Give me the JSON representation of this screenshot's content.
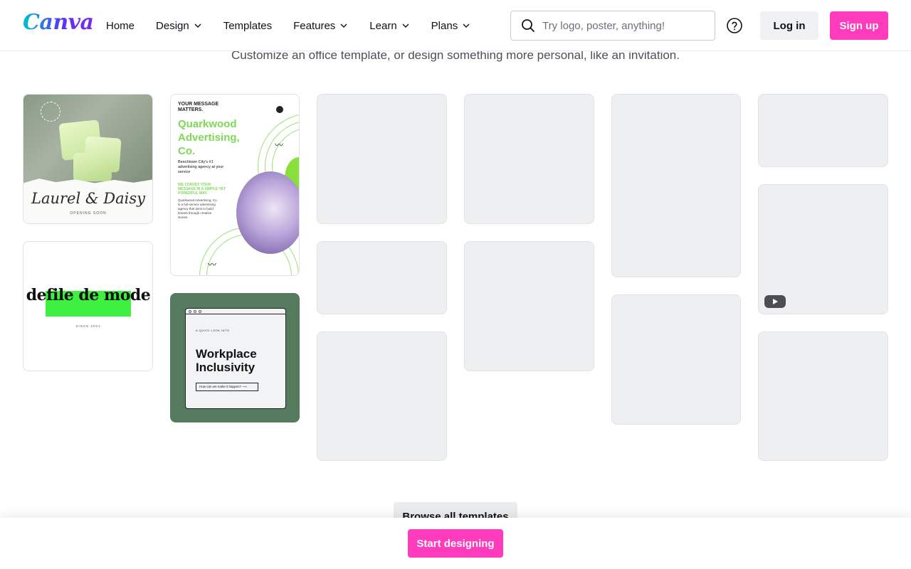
{
  "header": {
    "logo": "Canva",
    "nav": [
      {
        "label": "Home",
        "dropdown": false
      },
      {
        "label": "Design",
        "dropdown": true
      },
      {
        "label": "Templates",
        "dropdown": false
      },
      {
        "label": "Features",
        "dropdown": true
      },
      {
        "label": "Learn",
        "dropdown": true
      },
      {
        "label": "Plans",
        "dropdown": true
      }
    ],
    "search": {
      "placeholder": "Try logo, poster, anything!",
      "value": ""
    },
    "login_label": "Log in",
    "signup_label": "Sign up"
  },
  "subtitle": "Customize an office template, or design something more personal, like an invitation.",
  "templates": {
    "laurel": {
      "title": "Laurel & Daisy",
      "tagline": "OPENING SOON"
    },
    "quarkwood": {
      "top": "YOUR MESSAGE MATTERS.",
      "title": "Quarkwood Advertising, Co.",
      "line1": "Beechtown City's #1 advertising agency at your service",
      "line2": "WE CONVEY YOUR MESSAGE IN A SIMPLE YET POWERFUL WAY.",
      "line3": "Quarkwood Advertising, Co. is a full-service advertising agency that aims to build brands through creative stories."
    },
    "defile": {
      "title": "defile de mode",
      "since": "SINCE 2001"
    },
    "workplace": {
      "arc": "A QUICK LOOK INTO",
      "title": "Workplace Inclusivity",
      "question": "How can we make it happen?"
    }
  },
  "browse_label": "Browse all templates",
  "start_label": "Start designing",
  "colors": {
    "brand_pink": "#ff3bbd",
    "accent_green": "#7ed957",
    "placeholder_gray": "#eeeff1"
  }
}
